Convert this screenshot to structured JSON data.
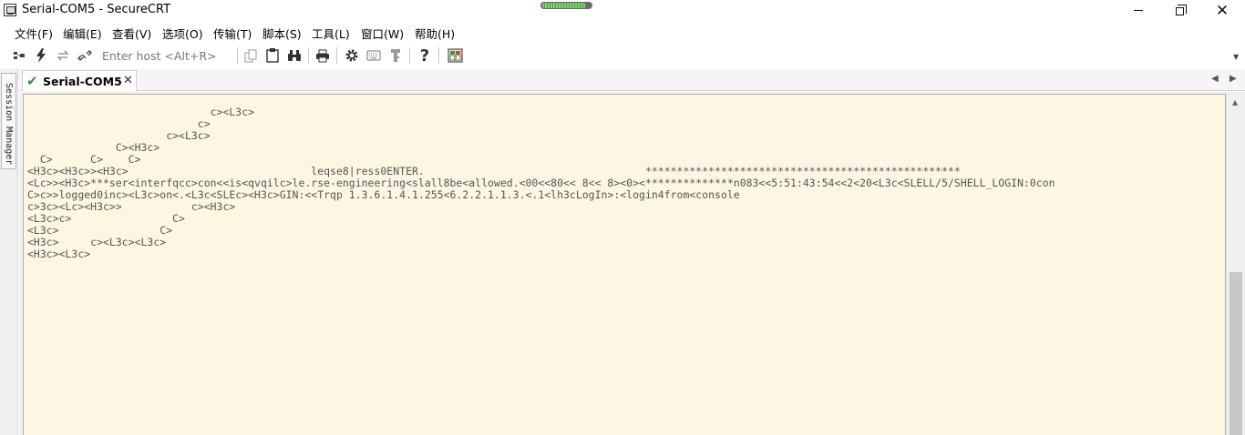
{
  "window": {
    "title": "Serial-COM5 - SecureCRT",
    "minimize_icon": "minimize-icon",
    "maximize_icon": "restore-icon",
    "close_glyph": "✕"
  },
  "connection_indicator": {
    "level_percent": 90,
    "color": "#4aa43e"
  },
  "menu": [
    "文件(F)",
    "编辑(E)",
    "查看(V)",
    "选项(O)",
    "传输(T)",
    "脚本(S)",
    "工具(L)",
    "窗口(W)",
    "帮助(H)"
  ],
  "toolbar": {
    "host_placeholder": "Enter host <Alt+R>",
    "icons": [
      "connect-bar-icon",
      "quick-connect-icon",
      "reconnect-icon",
      "disconnect-icon",
      "copy-icon",
      "paste-icon",
      "find-icon",
      "print-icon",
      "settings-icon",
      "keymap-icon",
      "key-agent-icon",
      "help-icon",
      "sftp-icon"
    ],
    "help_glyph": "?"
  },
  "sidebar": {
    "session_manager_label": "Session Manager"
  },
  "tabs": [
    {
      "label": "Serial-COM5",
      "status": "connected",
      "close_glyph": "✕"
    }
  ],
  "terminal": {
    "background": "#fdf6e3",
    "lines": [
      "                             c><L3c>",
      "                           c>",
      "                      c><L3c>",
      "              C><H3c>",
      "  C>      C>    C>",
      "<H3c><H3c>><H3c>                             leqse8|ress0ENTER.                                   **************************************************",
      "<Lc>><H3c>***ser<interfqcc>con<<is<qvqilc>le.rse-engineering<slall8be<allowed.<00<<80<< 8<< 8><0><**************n083<<5:51:43:54<<2<20<L3c<SLELL/5/SHELL_LOGIN:0con",
      "C>c>>logged0inc><L3c>on<.<L3c<SLEc><H3c>GIN:<<Trqp 1.3.6.1.4.1.255<6.2.2.1.1.3.<.1<lh3cLogIn>:<login4from<console",
      "c>3c><Lc><H3c>>           c><H3c>",
      "<L3c>c>                C>",
      "<L3c>                C>",
      "<H3c>     c><L3c><L3c>",
      "<H3c><L3c>"
    ]
  }
}
